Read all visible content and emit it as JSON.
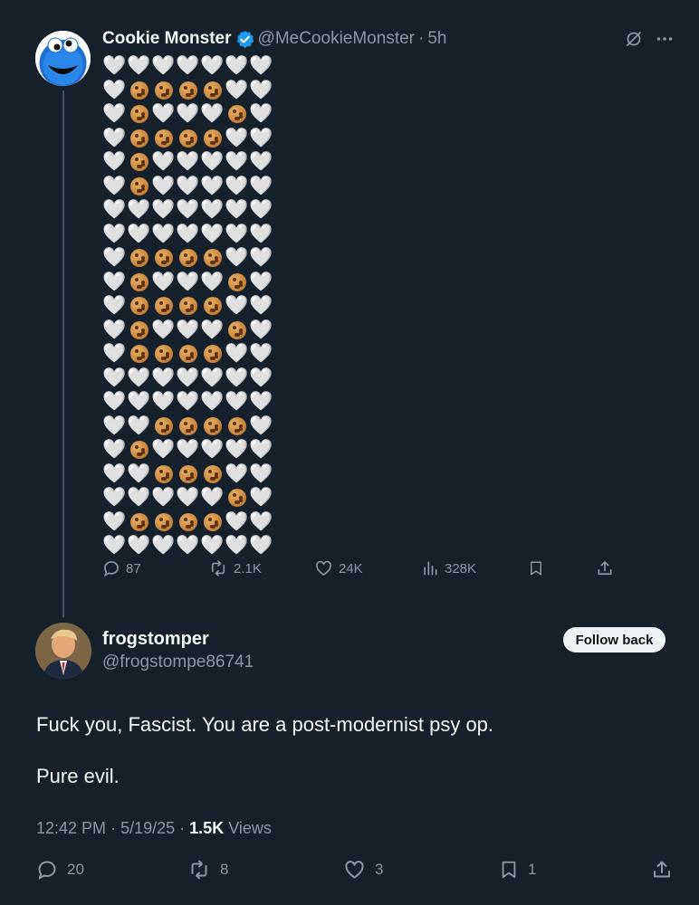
{
  "tweet": {
    "display_name": "Cookie Monster",
    "handle": "@MeCookieMonster",
    "separator": "·",
    "time": "5h",
    "verified_color": "#1d9bf0",
    "avatar_icon": "cookie-monster-avatar",
    "emoji_rows": [
      "WWWWWWW",
      "WCCCCWW",
      "WCWWWCW",
      "WCCCCWW",
      "WCWWWWW",
      "WCWWWWW",
      "WWWWWWW",
      "WWWWWWW",
      "WCCCCWW",
      "WCWWWCW",
      "WCCCCWW",
      "WCWWWCW",
      "WCCCCWW",
      "WWWWWWW",
      "WWWWWWW",
      "WWCCCCW",
      "WCWWWWW",
      "WWCCCWW",
      "WWWWWCW",
      "WCCCCWW",
      "WWWWWWW"
    ],
    "emoji_legend": {
      "W": "🤍",
      "C": "cookie"
    },
    "stats": {
      "replies": "87",
      "reposts": "2.1K",
      "likes": "24K",
      "views": "328K"
    }
  },
  "reply": {
    "display_name": "frogstomper",
    "handle": "@frogstompe86741",
    "follow_label": "Follow back",
    "body_line1": "Fuck you, Fascist. You are a post-modernist psy op.",
    "body_line2": "Pure evil.",
    "time": "12:42 PM",
    "date": "5/19/25",
    "dot": "·",
    "views_count": "1.5K",
    "views_label": "Views",
    "stats": {
      "replies": "20",
      "reposts": "8",
      "likes": "3",
      "bookmarks": "1"
    }
  },
  "colors": {
    "background": "#15202b",
    "text": "#f7f9f9",
    "muted": "#8b98a5",
    "verified": "#1d9bf0"
  }
}
